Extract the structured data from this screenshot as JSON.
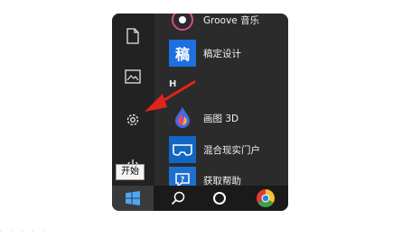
{
  "start_menu": {
    "rail": {
      "document": "document-icon",
      "pictures": "pictures-icon",
      "settings": "gear-icon",
      "power": "power-icon"
    },
    "section_letter": "H",
    "apps": [
      {
        "label": "Groove 音乐",
        "icon": "groove-music-icon",
        "color": "#1b1b1b"
      },
      {
        "label": "稿定设计",
        "icon": "gaoding-icon",
        "glyph": "稿",
        "color": "#1e6fe0"
      },
      {
        "label": "画图 3D",
        "icon": "paint-3d-icon",
        "color": "#1f5ed3"
      },
      {
        "label": "混合现实门户",
        "icon": "mixed-reality-icon",
        "color": "#1266c4"
      },
      {
        "label": "获取帮助",
        "icon": "get-help-icon",
        "color": "#1f6fd1"
      }
    ]
  },
  "taskbar": {
    "start": "windows-start-icon",
    "search": "search-icon",
    "cortana": "cortana-icon",
    "chrome": "chrome-icon"
  },
  "tooltip": {
    "label": "开始"
  },
  "annotation": {
    "color": "#e0241c"
  }
}
